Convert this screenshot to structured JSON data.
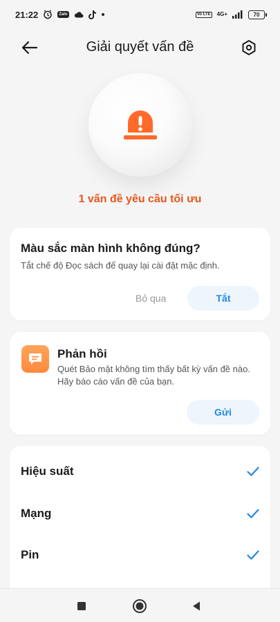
{
  "status_bar": {
    "time": "21:22",
    "zalo_label": "Zalo",
    "volte_label": "Vo LTE",
    "network_label": "4G+",
    "battery_level": "70",
    "icons": [
      "alarm-icon",
      "zalo-icon",
      "cloud-icon",
      "tiktok-icon",
      "dot-icon",
      "volte-icon",
      "signal-icon",
      "battery-icon"
    ]
  },
  "header": {
    "title": "Giải quyết vấn đề",
    "back_icon": "arrow-left-icon",
    "settings_icon": "hexagon-settings-icon"
  },
  "hero": {
    "icon": "alarm-light-icon",
    "summary": "1 vấn đề yêu cầu tối ưu",
    "accent_color": "#e8571b"
  },
  "issue_card": {
    "title": "Màu sắc màn hình không đúng?",
    "description": "Tắt chế độ Đọc sách để quay lại cài đặt mặc định.",
    "skip_label": "Bỏ qua",
    "action_label": "Tắt"
  },
  "feedback_card": {
    "icon": "chat-bubble-icon",
    "title": "Phản hồi",
    "description": "Quét Bảo mật không tìm thấy bất kỳ vấn đề nào. Hãy báo cáo vấn đề của bạn.",
    "send_label": "Gửi"
  },
  "checks": [
    {
      "label": "Hiệu suất",
      "status": "ok"
    },
    {
      "label": "Mạng",
      "status": "ok"
    },
    {
      "label": "Pin",
      "status": "ok"
    }
  ],
  "colors": {
    "check": "#1e88e5",
    "button_bg": "#eef5fc",
    "button_text": "#1e88e5"
  },
  "nav_bar": {
    "icons": [
      "recent-apps-icon",
      "home-icon",
      "back-icon"
    ]
  }
}
